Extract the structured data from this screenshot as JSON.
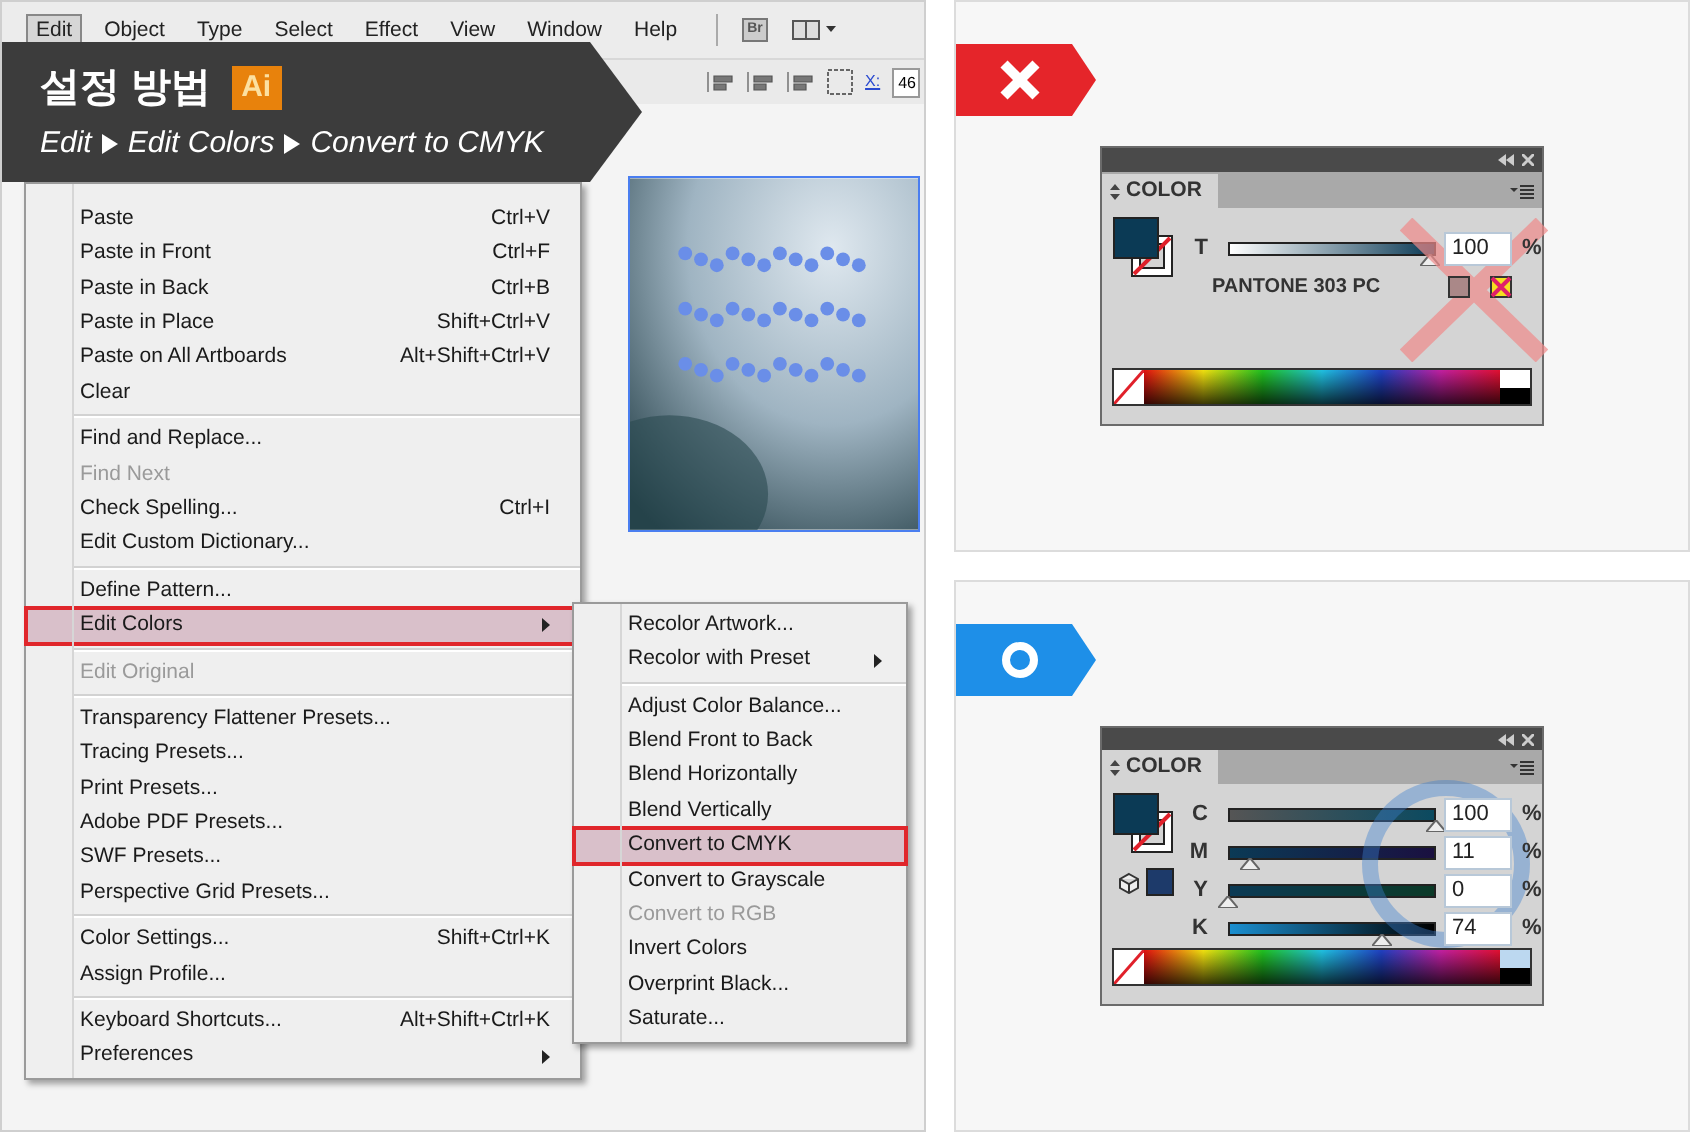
{
  "menu_bar": [
    {
      "label": "Edit",
      "selected": true
    },
    {
      "label": "Object",
      "selected": false
    },
    {
      "label": "Type",
      "selected": false
    },
    {
      "label": "Select",
      "selected": false
    },
    {
      "label": "Effect",
      "selected": false
    },
    {
      "label": "View",
      "selected": false
    },
    {
      "label": "Window",
      "selected": false
    },
    {
      "label": "Help",
      "selected": false
    }
  ],
  "app_button": "Br",
  "control_bar": {
    "x_label": "X:",
    "x_value": "46"
  },
  "banner": {
    "title": "설정 방법",
    "app_badge": "Ai",
    "path": [
      "Edit",
      "Edit Colors",
      "Convert to CMYK"
    ]
  },
  "artboard": {
    "kind": "picture"
  },
  "edit_menu": [
    [
      {
        "label": "Paste",
        "shortcut": "Ctrl+V",
        "kind": "command",
        "disabled": false,
        "selected": false
      },
      {
        "label": "Paste in Front",
        "shortcut": "Ctrl+F",
        "kind": "command",
        "disabled": false,
        "selected": false
      },
      {
        "label": "Paste in Back",
        "shortcut": "Ctrl+B",
        "kind": "command",
        "disabled": false,
        "selected": false
      },
      {
        "label": "Paste in Place",
        "shortcut": "Shift+Ctrl+V",
        "kind": "command",
        "disabled": false,
        "selected": false
      },
      {
        "label": "Paste on All Artboards",
        "shortcut": "Alt+Shift+Ctrl+V",
        "kind": "command",
        "disabled": false,
        "selected": false
      },
      {
        "label": "Clear",
        "kind": "command",
        "disabled": false,
        "selected": false
      }
    ],
    [
      {
        "label": "Find and Replace...",
        "kind": "command",
        "disabled": false,
        "selected": false
      },
      {
        "label": "Find Next",
        "kind": "command",
        "disabled": true,
        "selected": false
      },
      {
        "label": "Check Spelling...",
        "shortcut": "Ctrl+I",
        "kind": "command",
        "disabled": false,
        "selected": false
      },
      {
        "label": "Edit Custom Dictionary...",
        "kind": "command",
        "disabled": false,
        "selected": false
      }
    ],
    [
      {
        "label": "Define Pattern...",
        "kind": "command",
        "disabled": false,
        "selected": false
      },
      {
        "label": "Edit Colors",
        "kind": "submenu",
        "disabled": false,
        "selected": true
      }
    ],
    [
      {
        "label": "Edit Original",
        "kind": "command",
        "disabled": true,
        "selected": false
      }
    ],
    [
      {
        "label": "Transparency Flattener Presets...",
        "kind": "command",
        "disabled": false,
        "selected": false
      },
      {
        "label": "Tracing Presets...",
        "kind": "command",
        "disabled": false,
        "selected": false
      },
      {
        "label": "Print Presets...",
        "kind": "command",
        "disabled": false,
        "selected": false
      },
      {
        "label": "Adobe PDF Presets...",
        "kind": "command",
        "disabled": false,
        "selected": false
      },
      {
        "label": "SWF Presets...",
        "kind": "command",
        "disabled": false,
        "selected": false
      },
      {
        "label": "Perspective Grid Presets...",
        "kind": "command",
        "disabled": false,
        "selected": false
      }
    ],
    [
      {
        "label": "Color Settings...",
        "shortcut": "Shift+Ctrl+K",
        "kind": "command",
        "disabled": false,
        "selected": false
      },
      {
        "label": "Assign Profile...",
        "kind": "command",
        "disabled": false,
        "selected": false
      }
    ],
    [
      {
        "label": "Keyboard Shortcuts...",
        "shortcut": "Alt+Shift+Ctrl+K",
        "kind": "command",
        "disabled": false,
        "selected": false
      },
      {
        "label": "Preferences",
        "kind": "submenu",
        "disabled": false,
        "selected": false
      }
    ]
  ],
  "edit_colors_submenu": [
    [
      {
        "label": "Recolor Artwork...",
        "kind": "command",
        "disabled": false,
        "selected": false
      },
      {
        "label": "Recolor with Preset",
        "kind": "submenu",
        "disabled": false,
        "selected": false
      }
    ],
    [
      {
        "label": "Adjust Color Balance...",
        "kind": "command",
        "disabled": false,
        "selected": false
      },
      {
        "label": "Blend Front to Back",
        "kind": "command",
        "disabled": false,
        "selected": false
      },
      {
        "label": "Blend Horizontally",
        "kind": "command",
        "disabled": false,
        "selected": false
      },
      {
        "label": "Blend Vertically",
        "kind": "command",
        "disabled": false,
        "selected": false
      },
      {
        "label": "Convert to CMYK",
        "kind": "command",
        "disabled": false,
        "selected": true
      },
      {
        "label": "Convert to Grayscale",
        "kind": "command",
        "disabled": false,
        "selected": false
      },
      {
        "label": "Convert to RGB",
        "kind": "command",
        "disabled": true,
        "selected": false
      },
      {
        "label": "Invert Colors",
        "kind": "command",
        "disabled": false,
        "selected": false
      },
      {
        "label": "Overprint Black...",
        "kind": "command",
        "disabled": false,
        "selected": false
      },
      {
        "label": "Saturate...",
        "kind": "command",
        "disabled": false,
        "selected": false
      }
    ]
  ],
  "examples": [
    {
      "kind": "wrong",
      "panel": {
        "title": "COLOR",
        "swatch_name": "PANTONE 303 PC",
        "sliders": [
          {
            "kind": "tint",
            "label": "T",
            "level": 0.97,
            "value": "100",
            "unit": "%"
          }
        ]
      }
    },
    {
      "kind": "right",
      "panel": {
        "title": "COLOR",
        "sliders": [
          {
            "kind": "cyan",
            "label": "C",
            "level": 1,
            "value": "100",
            "unit": "%"
          },
          {
            "kind": "magenta",
            "label": "M",
            "level": 0.11,
            "value": "11",
            "unit": "%"
          },
          {
            "kind": "yellow",
            "label": "Y",
            "level": 0,
            "value": "0",
            "unit": "%"
          },
          {
            "kind": "black",
            "label": "K",
            "level": 0.74,
            "value": "74",
            "unit": "%"
          }
        ]
      }
    }
  ]
}
